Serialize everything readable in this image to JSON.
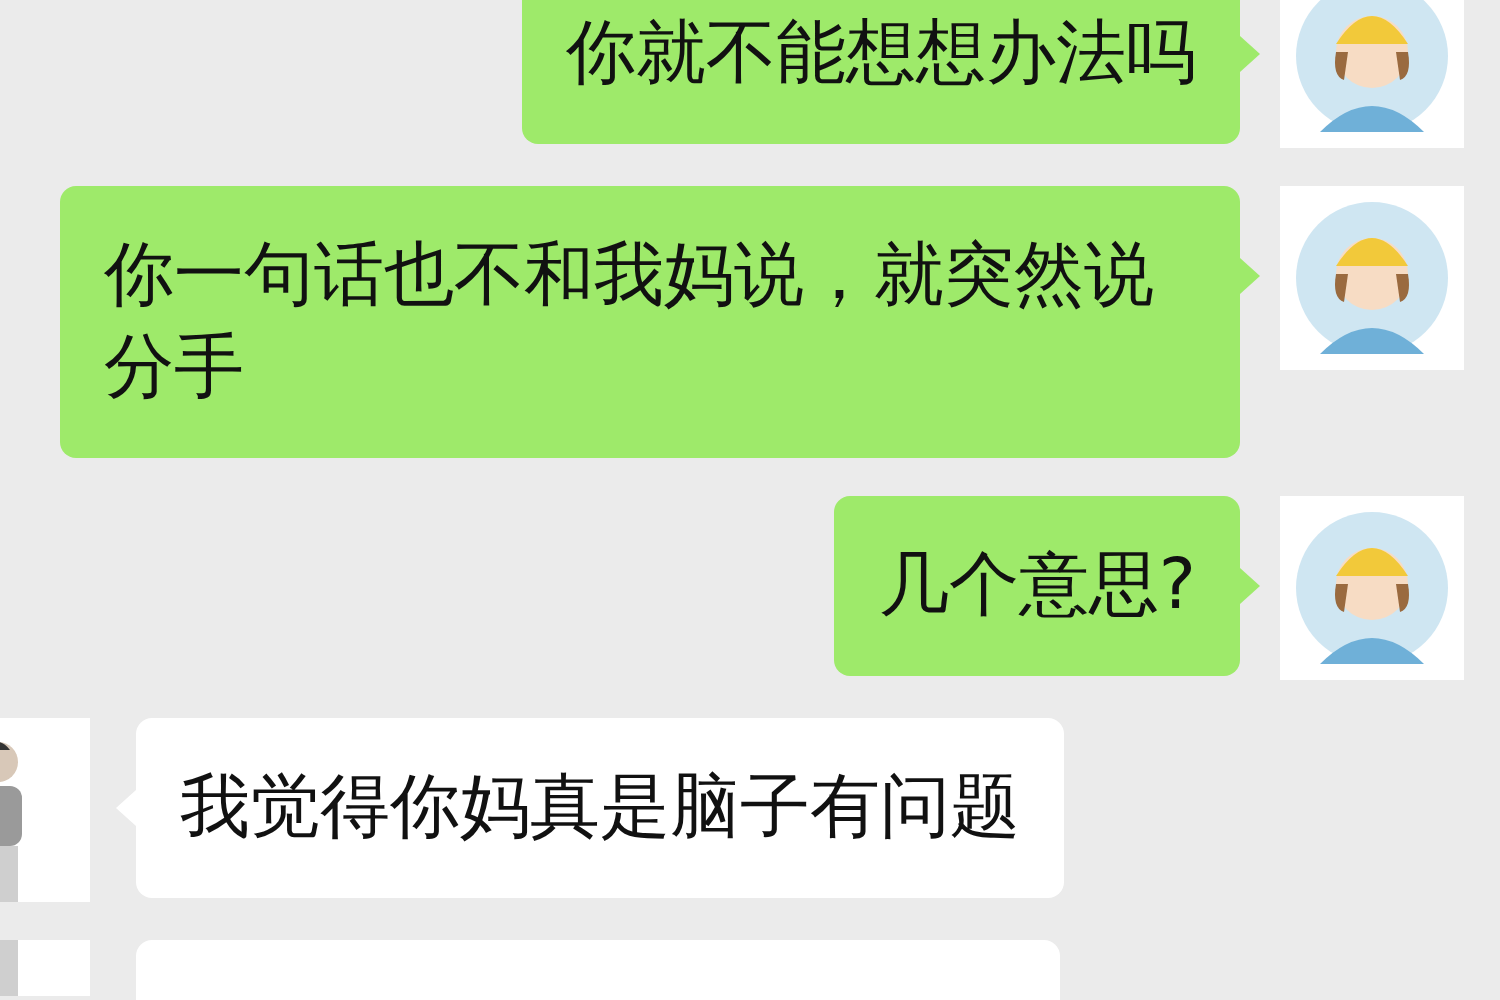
{
  "messages": [
    {
      "kind": "sent",
      "text": "你就不能想想办法吗"
    },
    {
      "kind": "sent",
      "text": "你一句话也不和我妈说，就突然说分手"
    },
    {
      "kind": "sent",
      "text": "几个意思?"
    },
    {
      "kind": "received",
      "text": "我觉得你妈真是脑子有问题"
    },
    {
      "kind": "received"
    }
  ]
}
